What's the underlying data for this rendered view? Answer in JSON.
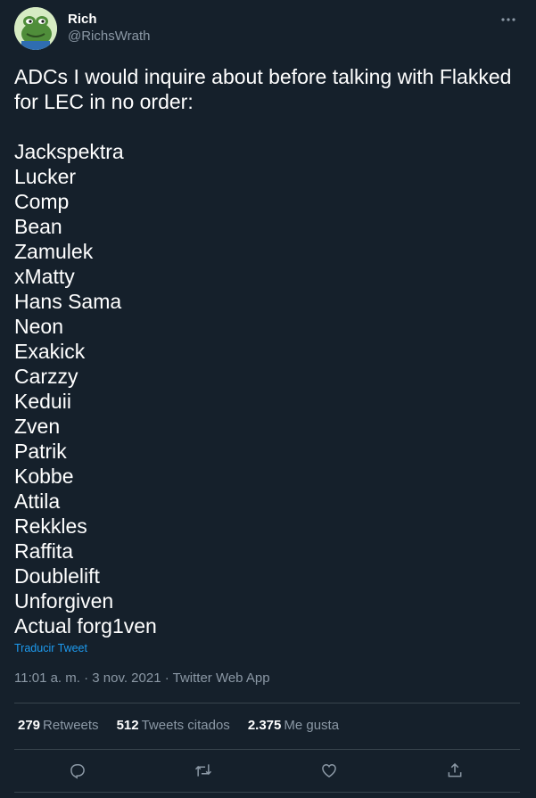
{
  "user": {
    "name": "Rich",
    "handle": "@RichsWrath"
  },
  "tweet": {
    "intro_lines": [
      "ADCs I would inquire about before talking with Flakked",
      "for LEC in no order:"
    ],
    "players": [
      "Jackspektra",
      "Lucker",
      "Comp",
      "Bean",
      "Zamulek",
      "xMatty",
      "Hans Sama",
      "Neon",
      "Exakick",
      "Carzzy",
      "Keduii",
      "Zven",
      "Patrik",
      "Kobbe",
      "Attila",
      "Rekkles",
      "Raffita",
      "Doublelift",
      "Unforgiven",
      "Actual forg1ven"
    ]
  },
  "translate_label": "Traducir Tweet",
  "meta": "11:01 a. m. · 3 nov. 2021 · Twitter Web App",
  "stats": {
    "retweets": {
      "count": "279",
      "label": "Retweets"
    },
    "quotes": {
      "count": "512",
      "label": "Tweets citados"
    },
    "likes": {
      "count": "2.375",
      "label": "Me gusta"
    }
  },
  "icons": {
    "more": "more-horizontal-icon",
    "reply": "reply-icon",
    "retweet": "retweet-icon",
    "like": "heart-icon",
    "share": "share-icon"
  },
  "colors": {
    "background": "#15202b",
    "text": "#ffffff",
    "secondary": "#8b98a5",
    "accent": "#1d9bf0",
    "border": "#38444d"
  }
}
